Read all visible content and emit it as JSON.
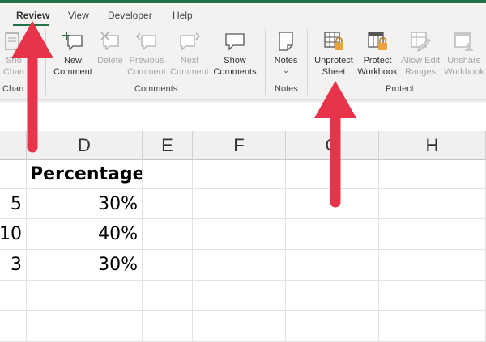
{
  "tabs": [
    {
      "label": "Review",
      "active": true
    },
    {
      "label": "View",
      "active": false
    },
    {
      "label": "Developer",
      "active": false
    },
    {
      "label": "Help",
      "active": false
    }
  ],
  "ribbon": {
    "partial": {
      "label_line1": "Sho",
      "label_line2": "Chan",
      "group": "Chan"
    },
    "comments": {
      "new_line1": "New",
      "new_line2": "Comment",
      "delete": "Delete",
      "prev_line1": "Previous",
      "prev_line2": "Comment",
      "next_line1": "Next",
      "next_line2": "Comment",
      "show_line1": "Show",
      "show_line2": "Comments",
      "group": "Comments"
    },
    "notes": {
      "label": "Notes",
      "chevron": "⌄",
      "group": "Notes"
    },
    "protect": {
      "unprotect_line1": "Unprotect",
      "unprotect_line2": "Sheet",
      "protect_line1": "Protect",
      "protect_line2": "Workbook",
      "allow_line1": "Allow Edit",
      "allow_line2": "Ranges",
      "unshare_line1": "Unshare",
      "unshare_line2": "Workbook",
      "group": "Protect"
    }
  },
  "columns": [
    "D",
    "E",
    "F",
    "G",
    "H"
  ],
  "rows": [
    {
      "c": "",
      "d": "Percentage"
    },
    {
      "c": "5",
      "d": "30%"
    },
    {
      "c": "10",
      "d": "40%"
    },
    {
      "c": "3",
      "d": "30%"
    }
  ],
  "colors": {
    "accent": "#217346",
    "arrow": "#e8344a"
  }
}
